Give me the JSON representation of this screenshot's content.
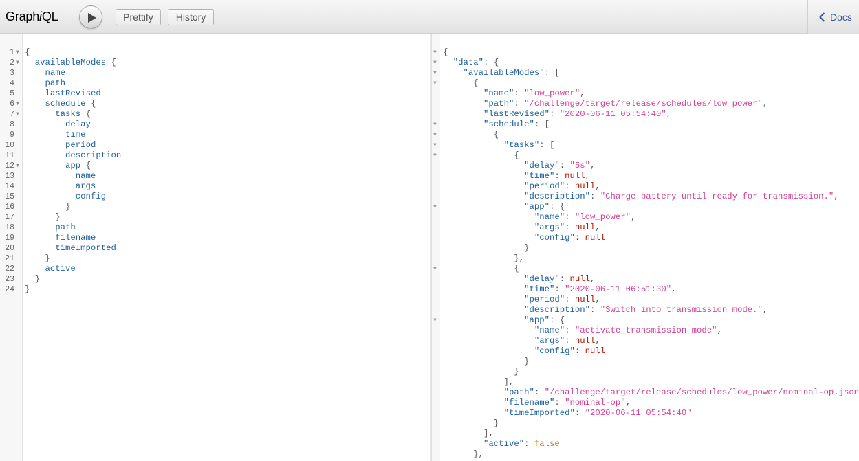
{
  "topbar": {
    "logo_a": "Graph",
    "logo_b": "i",
    "logo_c": "QL",
    "prettify_label": "Prettify",
    "history_label": "History",
    "docs_label": "Docs"
  },
  "colors": {
    "field": "#1f61a0",
    "key": "#1f61a0",
    "string": "#d64292",
    "null": "#b11a04",
    "boolean": "#d47509",
    "punct": "#555555"
  },
  "icons": [
    "play-icon",
    "chevron-left-icon",
    "fold-arrow-icon"
  ],
  "query_lines": [
    {
      "n": "1",
      "fold": true,
      "parts": [
        {
          "t": "{",
          "c": "p"
        }
      ]
    },
    {
      "n": "2",
      "fold": true,
      "parts": [
        {
          "t": "  "
        },
        {
          "t": "availableModes",
          "c": "f"
        },
        {
          "t": " {",
          "c": "p"
        }
      ]
    },
    {
      "n": "3",
      "parts": [
        {
          "t": "    "
        },
        {
          "t": "name",
          "c": "f"
        }
      ]
    },
    {
      "n": "4",
      "parts": [
        {
          "t": "    "
        },
        {
          "t": "path",
          "c": "f"
        }
      ]
    },
    {
      "n": "5",
      "parts": [
        {
          "t": "    "
        },
        {
          "t": "lastRevised",
          "c": "f"
        }
      ]
    },
    {
      "n": "6",
      "fold": true,
      "parts": [
        {
          "t": "    "
        },
        {
          "t": "schedule",
          "c": "f"
        },
        {
          "t": " {",
          "c": "p"
        }
      ]
    },
    {
      "n": "7",
      "fold": true,
      "parts": [
        {
          "t": "      "
        },
        {
          "t": "tasks",
          "c": "f"
        },
        {
          "t": " {",
          "c": "p"
        }
      ]
    },
    {
      "n": "8",
      "parts": [
        {
          "t": "        "
        },
        {
          "t": "delay",
          "c": "f"
        }
      ]
    },
    {
      "n": "9",
      "parts": [
        {
          "t": "        "
        },
        {
          "t": "time",
          "c": "f"
        }
      ]
    },
    {
      "n": "10",
      "parts": [
        {
          "t": "        "
        },
        {
          "t": "period",
          "c": "f"
        }
      ]
    },
    {
      "n": "11",
      "parts": [
        {
          "t": "        "
        },
        {
          "t": "description",
          "c": "f"
        }
      ]
    },
    {
      "n": "12",
      "fold": true,
      "parts": [
        {
          "t": "        "
        },
        {
          "t": "app",
          "c": "f"
        },
        {
          "t": " {",
          "c": "p"
        }
      ]
    },
    {
      "n": "13",
      "parts": [
        {
          "t": "          "
        },
        {
          "t": "name",
          "c": "f"
        }
      ]
    },
    {
      "n": "14",
      "parts": [
        {
          "t": "          "
        },
        {
          "t": "args",
          "c": "f"
        }
      ]
    },
    {
      "n": "15",
      "parts": [
        {
          "t": "          "
        },
        {
          "t": "config",
          "c": "f"
        }
      ]
    },
    {
      "n": "16",
      "parts": [
        {
          "t": "        }",
          "c": "p"
        }
      ]
    },
    {
      "n": "17",
      "parts": [
        {
          "t": "      }",
          "c": "p"
        }
      ]
    },
    {
      "n": "18",
      "parts": [
        {
          "t": "      "
        },
        {
          "t": "path",
          "c": "f"
        }
      ]
    },
    {
      "n": "19",
      "parts": [
        {
          "t": "      "
        },
        {
          "t": "filename",
          "c": "f"
        }
      ]
    },
    {
      "n": "20",
      "parts": [
        {
          "t": "      "
        },
        {
          "t": "timeImported",
          "c": "f"
        }
      ]
    },
    {
      "n": "21",
      "parts": [
        {
          "t": "    }",
          "c": "p"
        }
      ]
    },
    {
      "n": "22",
      "parts": [
        {
          "t": "    "
        },
        {
          "t": "active",
          "c": "f"
        }
      ]
    },
    {
      "n": "23",
      "parts": [
        {
          "t": "  }",
          "c": "p"
        }
      ]
    },
    {
      "n": "24",
      "parts": [
        {
          "t": "}",
          "c": "p"
        }
      ]
    }
  ],
  "result_lines": [
    {
      "fold": true,
      "parts": [
        {
          "t": "{",
          "c": "p"
        }
      ]
    },
    {
      "fold": true,
      "parts": [
        {
          "t": "  "
        },
        {
          "t": "\"data\"",
          "c": "k"
        },
        {
          "t": ": {",
          "c": "p"
        }
      ]
    },
    {
      "fold": true,
      "parts": [
        {
          "t": "    "
        },
        {
          "t": "\"availableModes\"",
          "c": "k"
        },
        {
          "t": ": [",
          "c": "p"
        }
      ]
    },
    {
      "fold": true,
      "parts": [
        {
          "t": "      {",
          "c": "p"
        }
      ]
    },
    {
      "parts": [
        {
          "t": "        "
        },
        {
          "t": "\"name\"",
          "c": "k"
        },
        {
          "t": ": ",
          "c": "p"
        },
        {
          "t": "\"low_power\"",
          "c": "s"
        },
        {
          "t": ",",
          "c": "p"
        }
      ]
    },
    {
      "parts": [
        {
          "t": "        "
        },
        {
          "t": "\"path\"",
          "c": "k"
        },
        {
          "t": ": ",
          "c": "p"
        },
        {
          "t": "\"/challenge/target/release/schedules/low_power\"",
          "c": "s"
        },
        {
          "t": ",",
          "c": "p"
        }
      ]
    },
    {
      "parts": [
        {
          "t": "        "
        },
        {
          "t": "\"lastRevised\"",
          "c": "k"
        },
        {
          "t": ": ",
          "c": "p"
        },
        {
          "t": "\"2020-06-11 05:54:40\"",
          "c": "s"
        },
        {
          "t": ",",
          "c": "p"
        }
      ]
    },
    {
      "fold": true,
      "parts": [
        {
          "t": "        "
        },
        {
          "t": "\"schedule\"",
          "c": "k"
        },
        {
          "t": ": [",
          "c": "p"
        }
      ]
    },
    {
      "fold": true,
      "parts": [
        {
          "t": "          {",
          "c": "p"
        }
      ]
    },
    {
      "fold": true,
      "parts": [
        {
          "t": "            "
        },
        {
          "t": "\"tasks\"",
          "c": "k"
        },
        {
          "t": ": [",
          "c": "p"
        }
      ]
    },
    {
      "fold": true,
      "parts": [
        {
          "t": "              {",
          "c": "p"
        }
      ]
    },
    {
      "parts": [
        {
          "t": "                "
        },
        {
          "t": "\"delay\"",
          "c": "k"
        },
        {
          "t": ": ",
          "c": "p"
        },
        {
          "t": "\"5s\"",
          "c": "s"
        },
        {
          "t": ",",
          "c": "p"
        }
      ]
    },
    {
      "parts": [
        {
          "t": "                "
        },
        {
          "t": "\"time\"",
          "c": "k"
        },
        {
          "t": ": ",
          "c": "p"
        },
        {
          "t": "null",
          "c": "n"
        },
        {
          "t": ",",
          "c": "p"
        }
      ]
    },
    {
      "parts": [
        {
          "t": "                "
        },
        {
          "t": "\"period\"",
          "c": "k"
        },
        {
          "t": ": ",
          "c": "p"
        },
        {
          "t": "null",
          "c": "n"
        },
        {
          "t": ",",
          "c": "p"
        }
      ]
    },
    {
      "parts": [
        {
          "t": "                "
        },
        {
          "t": "\"description\"",
          "c": "k"
        },
        {
          "t": ": ",
          "c": "p"
        },
        {
          "t": "\"Charge battery until ready for transmission.\"",
          "c": "s"
        },
        {
          "t": ",",
          "c": "p"
        }
      ]
    },
    {
      "fold": true,
      "parts": [
        {
          "t": "                "
        },
        {
          "t": "\"app\"",
          "c": "k"
        },
        {
          "t": ": {",
          "c": "p"
        }
      ]
    },
    {
      "parts": [
        {
          "t": "                  "
        },
        {
          "t": "\"name\"",
          "c": "k"
        },
        {
          "t": ": ",
          "c": "p"
        },
        {
          "t": "\"low_power\"",
          "c": "s"
        },
        {
          "t": ",",
          "c": "p"
        }
      ]
    },
    {
      "parts": [
        {
          "t": "                  "
        },
        {
          "t": "\"args\"",
          "c": "k"
        },
        {
          "t": ": ",
          "c": "p"
        },
        {
          "t": "null",
          "c": "n"
        },
        {
          "t": ",",
          "c": "p"
        }
      ]
    },
    {
      "parts": [
        {
          "t": "                  "
        },
        {
          "t": "\"config\"",
          "c": "k"
        },
        {
          "t": ": ",
          "c": "p"
        },
        {
          "t": "null",
          "c": "n"
        }
      ]
    },
    {
      "parts": [
        {
          "t": "                }",
          "c": "p"
        }
      ]
    },
    {
      "parts": [
        {
          "t": "              },",
          "c": "p"
        }
      ]
    },
    {
      "fold": true,
      "parts": [
        {
          "t": "              {",
          "c": "p"
        }
      ]
    },
    {
      "parts": [
        {
          "t": "                "
        },
        {
          "t": "\"delay\"",
          "c": "k"
        },
        {
          "t": ": ",
          "c": "p"
        },
        {
          "t": "null",
          "c": "n"
        },
        {
          "t": ",",
          "c": "p"
        }
      ]
    },
    {
      "parts": [
        {
          "t": "                "
        },
        {
          "t": "\"time\"",
          "c": "k"
        },
        {
          "t": ": ",
          "c": "p"
        },
        {
          "t": "\"2020-06-11 06:51:30\"",
          "c": "s"
        },
        {
          "t": ",",
          "c": "p"
        }
      ]
    },
    {
      "parts": [
        {
          "t": "                "
        },
        {
          "t": "\"period\"",
          "c": "k"
        },
        {
          "t": ": ",
          "c": "p"
        },
        {
          "t": "null",
          "c": "n"
        },
        {
          "t": ",",
          "c": "p"
        }
      ]
    },
    {
      "parts": [
        {
          "t": "                "
        },
        {
          "t": "\"description\"",
          "c": "k"
        },
        {
          "t": ": ",
          "c": "p"
        },
        {
          "t": "\"Switch into transmission mode.\"",
          "c": "s"
        },
        {
          "t": ",",
          "c": "p"
        }
      ]
    },
    {
      "fold": true,
      "parts": [
        {
          "t": "                "
        },
        {
          "t": "\"app\"",
          "c": "k"
        },
        {
          "t": ": {",
          "c": "p"
        }
      ]
    },
    {
      "parts": [
        {
          "t": "                  "
        },
        {
          "t": "\"name\"",
          "c": "k"
        },
        {
          "t": ": ",
          "c": "p"
        },
        {
          "t": "\"activate_transmission_mode\"",
          "c": "s"
        },
        {
          "t": ",",
          "c": "p"
        }
      ]
    },
    {
      "parts": [
        {
          "t": "                  "
        },
        {
          "t": "\"args\"",
          "c": "k"
        },
        {
          "t": ": ",
          "c": "p"
        },
        {
          "t": "null",
          "c": "n"
        },
        {
          "t": ",",
          "c": "p"
        }
      ]
    },
    {
      "parts": [
        {
          "t": "                  "
        },
        {
          "t": "\"config\"",
          "c": "k"
        },
        {
          "t": ": ",
          "c": "p"
        },
        {
          "t": "null",
          "c": "n"
        }
      ]
    },
    {
      "parts": [
        {
          "t": "                }",
          "c": "p"
        }
      ]
    },
    {
      "parts": [
        {
          "t": "              }",
          "c": "p"
        }
      ]
    },
    {
      "parts": [
        {
          "t": "            ],",
          "c": "p"
        }
      ]
    },
    {
      "parts": [
        {
          "t": "            "
        },
        {
          "t": "\"path\"",
          "c": "k"
        },
        {
          "t": ": ",
          "c": "p"
        },
        {
          "t": "\"/challenge/target/release/schedules/low_power/nominal-op.json\"",
          "c": "s"
        },
        {
          "t": ",",
          "c": "p"
        }
      ]
    },
    {
      "parts": [
        {
          "t": "            "
        },
        {
          "t": "\"filename\"",
          "c": "k"
        },
        {
          "t": ": ",
          "c": "p"
        },
        {
          "t": "\"nominal-op\"",
          "c": "s"
        },
        {
          "t": ",",
          "c": "p"
        }
      ]
    },
    {
      "parts": [
        {
          "t": "            "
        },
        {
          "t": "\"timeImported\"",
          "c": "k"
        },
        {
          "t": ": ",
          "c": "p"
        },
        {
          "t": "\"2020-06-11 05:54:40\"",
          "c": "s"
        }
      ]
    },
    {
      "parts": [
        {
          "t": "          }",
          "c": "p"
        }
      ]
    },
    {
      "parts": [
        {
          "t": "        ],",
          "c": "p"
        }
      ]
    },
    {
      "parts": [
        {
          "t": "        "
        },
        {
          "t": "\"active\"",
          "c": "k"
        },
        {
          "t": ": ",
          "c": "p"
        },
        {
          "t": "false",
          "c": "b"
        }
      ]
    },
    {
      "parts": [
        {
          "t": "      },",
          "c": "p"
        }
      ]
    }
  ]
}
